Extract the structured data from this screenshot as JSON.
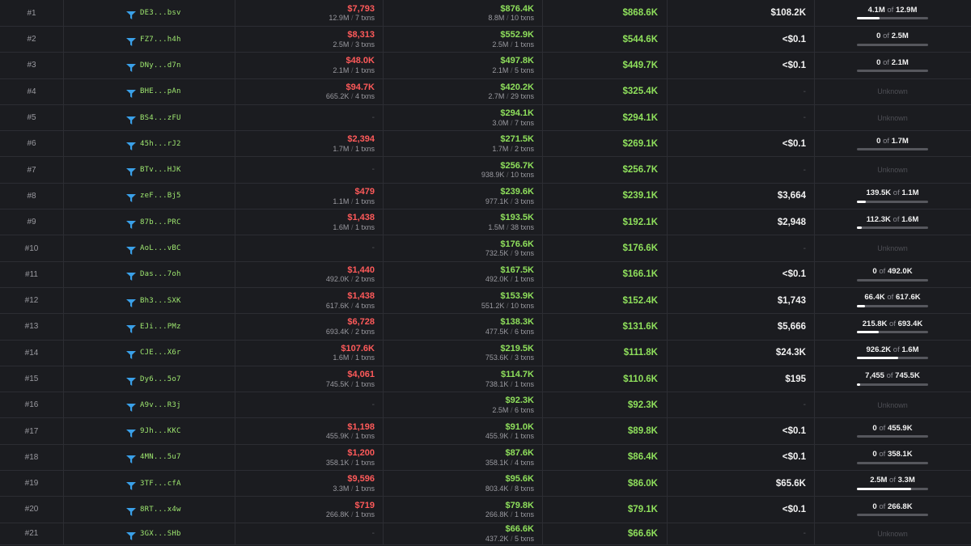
{
  "rows": [
    {
      "rank": "#1",
      "address": "DE3...bsv",
      "bought": "$7,793",
      "bought_tokens": "12.9M",
      "bought_txns": "7 txns",
      "sold": "$876.4K",
      "sold_tokens": "8.8M",
      "sold_txns": "10 txns",
      "pnl": "$868.6K",
      "unrealized": "$108.2K",
      "held": "4.1M",
      "of": "of",
      "total": "12.9M",
      "fraction": 0.32
    },
    {
      "rank": "#2",
      "address": "FZ7...h4h",
      "bought": "$8,313",
      "bought_tokens": "2.5M",
      "bought_txns": "3 txns",
      "sold": "$552.9K",
      "sold_tokens": "2.5M",
      "sold_txns": "1 txns",
      "pnl": "$544.6K",
      "unrealized": "<$0.1",
      "held": "0",
      "of": "of",
      "total": "2.5M",
      "fraction": 0
    },
    {
      "rank": "#3",
      "address": "DNy...d7n",
      "bought": "$48.0K",
      "bought_tokens": "2.1M",
      "bought_txns": "1 txns",
      "sold": "$497.8K",
      "sold_tokens": "2.1M",
      "sold_txns": "5 txns",
      "pnl": "$449.7K",
      "unrealized": "<$0.1",
      "held": "0",
      "of": "of",
      "total": "2.1M",
      "fraction": 0
    },
    {
      "rank": "#4",
      "address": "BHE...pAn",
      "bought": "$94.7K",
      "bought_tokens": "665.2K",
      "bought_txns": "4 txns",
      "sold": "$420.2K",
      "sold_tokens": "2.7M",
      "sold_txns": "29 txns",
      "pnl": "$325.4K",
      "unrealized": "-",
      "unknown": "Unknown"
    },
    {
      "rank": "#5",
      "address": "BS4...zFU",
      "bought": "-",
      "sold": "$294.1K",
      "sold_tokens": "3.0M",
      "sold_txns": "7 txns",
      "pnl": "$294.1K",
      "unrealized": "-",
      "unknown": "Unknown"
    },
    {
      "rank": "#6",
      "address": "45h...rJ2",
      "bought": "$2,394",
      "bought_tokens": "1.7M",
      "bought_txns": "1 txns",
      "sold": "$271.5K",
      "sold_tokens": "1.7M",
      "sold_txns": "2 txns",
      "pnl": "$269.1K",
      "unrealized": "<$0.1",
      "held": "0",
      "of": "of",
      "total": "1.7M",
      "fraction": 0
    },
    {
      "rank": "#7",
      "address": "BTv...HJK",
      "bought": "-",
      "sold": "$256.7K",
      "sold_tokens": "938.9K",
      "sold_txns": "10 txns",
      "pnl": "$256.7K",
      "unrealized": "-",
      "unknown": "Unknown"
    },
    {
      "rank": "#8",
      "address": "zeF...Bj5",
      "bought": "$479",
      "bought_tokens": "1.1M",
      "bought_txns": "1 txns",
      "sold": "$239.6K",
      "sold_tokens": "977.1K",
      "sold_txns": "3 txns",
      "pnl": "$239.1K",
      "unrealized": "$3,664",
      "held": "139.5K",
      "of": "of",
      "total": "1.1M",
      "fraction": 0.13
    },
    {
      "rank": "#9",
      "address": "87b...PRC",
      "bought": "$1,438",
      "bought_tokens": "1.6M",
      "bought_txns": "1 txns",
      "sold": "$193.5K",
      "sold_tokens": "1.5M",
      "sold_txns": "38 txns",
      "pnl": "$192.1K",
      "unrealized": "$2,948",
      "held": "112.3K",
      "of": "of",
      "total": "1.6M",
      "fraction": 0.07
    },
    {
      "rank": "#10",
      "address": "AoL...vBC",
      "bought": "-",
      "sold": "$176.6K",
      "sold_tokens": "732.5K",
      "sold_txns": "9 txns",
      "pnl": "$176.6K",
      "unrealized": "-",
      "unknown": "Unknown"
    },
    {
      "rank": "#11",
      "address": "Das...7oh",
      "bought": "$1,440",
      "bought_tokens": "492.0K",
      "bought_txns": "2 txns",
      "sold": "$167.5K",
      "sold_tokens": "492.0K",
      "sold_txns": "1 txns",
      "pnl": "$166.1K",
      "unrealized": "<$0.1",
      "held": "0",
      "of": "of",
      "total": "492.0K",
      "fraction": 0
    },
    {
      "rank": "#12",
      "address": "Bh3...SXK",
      "bought": "$1,438",
      "bought_tokens": "617.6K",
      "bought_txns": "4 txns",
      "sold": "$153.9K",
      "sold_tokens": "551.2K",
      "sold_txns": "10 txns",
      "pnl": "$152.4K",
      "unrealized": "$1,743",
      "held": "66.4K",
      "of": "of",
      "total": "617.6K",
      "fraction": 0.11
    },
    {
      "rank": "#13",
      "address": "EJi...PMz",
      "bought": "$6,728",
      "bought_tokens": "693.4K",
      "bought_txns": "2 txns",
      "sold": "$138.3K",
      "sold_tokens": "477.5K",
      "sold_txns": "6 txns",
      "pnl": "$131.6K",
      "unrealized": "$5,666",
      "held": "215.8K",
      "of": "of",
      "total": "693.4K",
      "fraction": 0.31
    },
    {
      "rank": "#14",
      "address": "CJE...X6r",
      "bought": "$107.6K",
      "bought_tokens": "1.6M",
      "bought_txns": "1 txns",
      "sold": "$219.5K",
      "sold_tokens": "753.6K",
      "sold_txns": "3 txns",
      "pnl": "$111.8K",
      "unrealized": "$24.3K",
      "held": "926.2K",
      "of": "of",
      "total": "1.6M",
      "fraction": 0.58
    },
    {
      "rank": "#15",
      "address": "Dy6...5o7",
      "bought": "$4,061",
      "bought_tokens": "745.5K",
      "bought_txns": "1 txns",
      "sold": "$114.7K",
      "sold_tokens": "738.1K",
      "sold_txns": "1 txns",
      "pnl": "$110.6K",
      "unrealized": "$195",
      "held": "7,455",
      "of": "of",
      "total": "745.5K",
      "fraction": 0.04
    },
    {
      "rank": "#16",
      "address": "A9v...R3j",
      "bought": "-",
      "sold": "$92.3K",
      "sold_tokens": "2.5M",
      "sold_txns": "6 txns",
      "pnl": "$92.3K",
      "unrealized": "-",
      "unknown": "Unknown"
    },
    {
      "rank": "#17",
      "address": "9Jh...KKC",
      "bought": "$1,198",
      "bought_tokens": "455.9K",
      "bought_txns": "1 txns",
      "sold": "$91.0K",
      "sold_tokens": "455.9K",
      "sold_txns": "1 txns",
      "pnl": "$89.8K",
      "unrealized": "<$0.1",
      "held": "0",
      "of": "of",
      "total": "455.9K",
      "fraction": 0
    },
    {
      "rank": "#18",
      "address": "4MN...5u7",
      "bought": "$1,200",
      "bought_tokens": "358.1K",
      "bought_txns": "1 txns",
      "sold": "$87.6K",
      "sold_tokens": "358.1K",
      "sold_txns": "4 txns",
      "pnl": "$86.4K",
      "unrealized": "<$0.1",
      "held": "0",
      "of": "of",
      "total": "358.1K",
      "fraction": 0
    },
    {
      "rank": "#19",
      "address": "3TF...cfA",
      "bought": "$9,596",
      "bought_tokens": "3.3M",
      "bought_txns": "1 txns",
      "sold": "$95.6K",
      "sold_tokens": "803.4K",
      "sold_txns": "8 txns",
      "pnl": "$86.0K",
      "unrealized": "$65.6K",
      "held": "2.5M",
      "of": "of",
      "total": "3.3M",
      "fraction": 0.76
    },
    {
      "rank": "#20",
      "address": "8RT...x4w",
      "bought": "$719",
      "bought_tokens": "266.8K",
      "bought_txns": "1 txns",
      "sold": "$79.8K",
      "sold_tokens": "266.8K",
      "sold_txns": "1 txns",
      "pnl": "$79.1K",
      "unrealized": "<$0.1",
      "held": "0",
      "of": "of",
      "total": "266.8K",
      "fraction": 0
    },
    {
      "rank": "#21",
      "address": "3GX...SHb",
      "bought": "-",
      "sold": "$66.6K",
      "sold_tokens": "437.2K",
      "sold_txns": "5 txns",
      "pnl": "$66.6K",
      "unrealized": "-",
      "unknown": "Unknown"
    }
  ],
  "colors": {
    "background": "#1b1c20",
    "border": "#2c2d33",
    "bought": "#ff5a5a",
    "sold": "#8fe05c",
    "address": "#9fe870",
    "icon": "#3aa0e8"
  },
  "icons": {
    "trader": "filter-funnel-icon"
  },
  "separator": "/"
}
